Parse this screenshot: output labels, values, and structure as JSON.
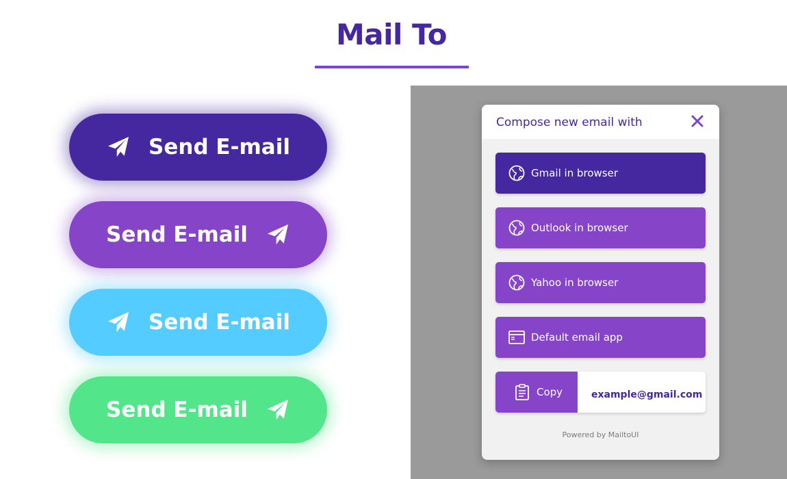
{
  "title": "Mail To",
  "colors": {
    "title": "#45279f",
    "underline": "#7b47c6",
    "btn_dark_purple": "#45279f",
    "btn_purple": "#8645c8",
    "btn_blue": "#55ccff",
    "btn_green": "#52e589",
    "overlay": "#9a9a9a"
  },
  "send_buttons": [
    {
      "label": "Send E-mail",
      "icon": "paper-plane-icon",
      "icon_position": "left"
    },
    {
      "label": "Send E-mail",
      "icon": "paper-plane-icon",
      "icon_position": "right"
    },
    {
      "label": "Send E-mail",
      "icon": "paper-plane-icon",
      "icon_position": "left"
    },
    {
      "label": "Send E-mail",
      "icon": "paper-plane-icon",
      "icon_position": "right"
    }
  ],
  "modal": {
    "title": "Compose new email with",
    "close_icon": "close-icon",
    "options": [
      {
        "label": "Gmail in browser",
        "icon": "globe-icon"
      },
      {
        "label": "Outlook in browser",
        "icon": "globe-icon"
      },
      {
        "label": "Yahoo in browser",
        "icon": "globe-icon"
      },
      {
        "label": "Default email app",
        "icon": "app-window-icon"
      }
    ],
    "copy": {
      "label": "Copy",
      "icon": "clipboard-icon",
      "email": "example@gmail.com"
    },
    "powered_by": "Powered by MailtoUI"
  }
}
